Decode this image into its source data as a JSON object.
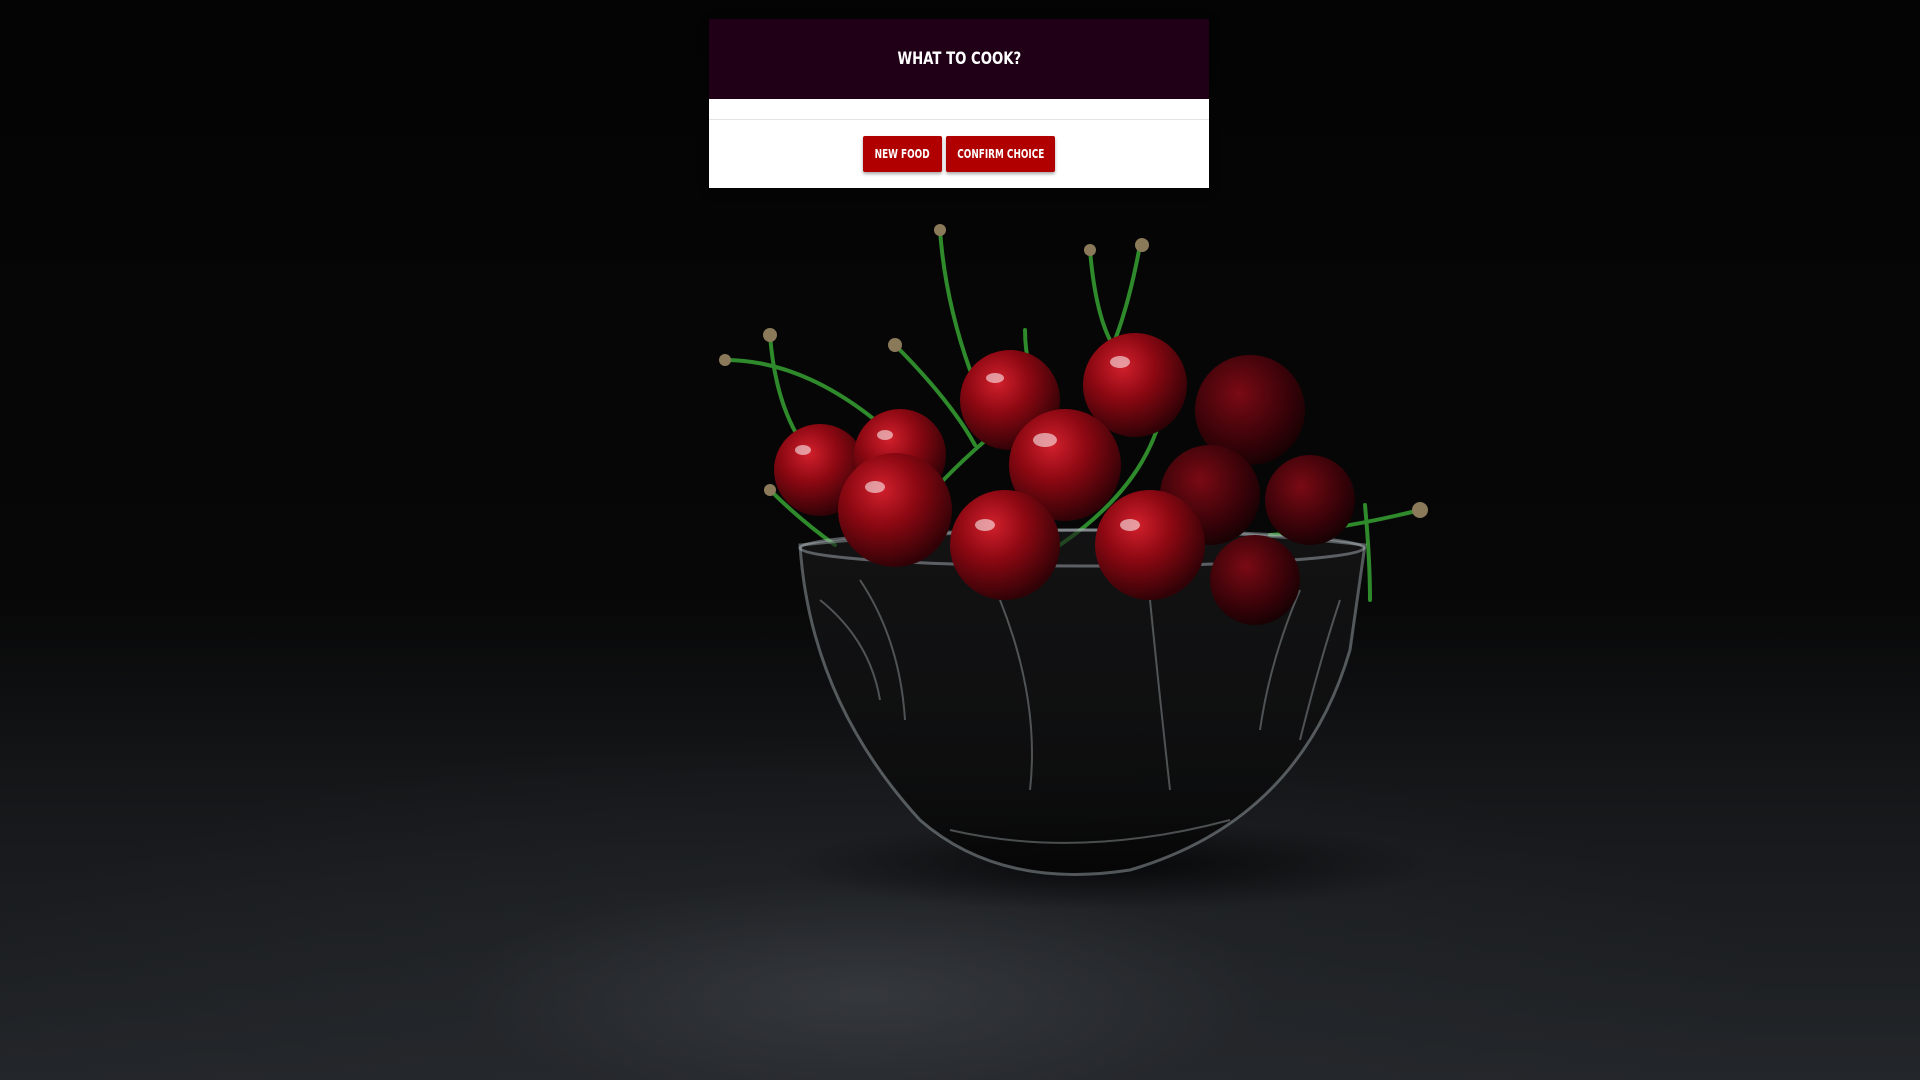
{
  "card": {
    "title": "What to cook?",
    "buttons": {
      "new_food": "New food",
      "confirm_choice": "Confirm choice"
    },
    "header_color": "#1f0016",
    "button_color": "#b00000"
  },
  "background": {
    "subject": "cherries-in-glass-bowl-photo"
  }
}
